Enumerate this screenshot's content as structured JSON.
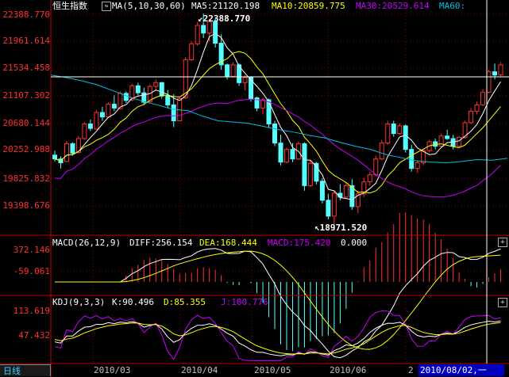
{
  "main_header": {
    "title": "恒生指数",
    "ma_label": "MA(5,10,30,60)",
    "ma5": "MA5:21120.198",
    "ma10": "MA10:20859.775",
    "ma30": "MA30:20529.614",
    "ma60": "MA60:"
  },
  "main_axis": {
    "labels": [
      "22388.770",
      "21961.614",
      "21534.458",
      "21107.302",
      "20680.144",
      "20252.988",
      "19825.832",
      "19398.676"
    ]
  },
  "annotations": {
    "high": "22388.770",
    "low": "18971.520"
  },
  "macd_header": {
    "label": "MACD(26,12,9)",
    "diff": "DIFF:256.154",
    "dea": "DEA:168.444",
    "macd": "MACD:175.420",
    "zero": "0.000"
  },
  "macd_axis": {
    "labels": [
      "372.146",
      "-59.061"
    ]
  },
  "kdj_header": {
    "label": "KDJ(9,3,3)",
    "k": "K:90.496",
    "d": "D:85.355",
    "j": "J:100.776"
  },
  "kdj_axis": {
    "labels": [
      "113.619",
      "47.432"
    ]
  },
  "bottom_bar": {
    "tab": "日线",
    "months": [
      "2010/03",
      "2010/04",
      "2010/05",
      "2010/06",
      "2"
    ],
    "current_date": "2010/08/02,一"
  },
  "panel_buttons": {
    "macd": "+",
    "kdj": "+"
  },
  "colors": {
    "rise": "#ff3232",
    "fall": "#54ffff",
    "ma5": "#ffffff",
    "ma10": "#ffff00",
    "ma30": "#c800ff",
    "ma60": "#00c0e0",
    "grid": "#800000"
  },
  "chart_data": {
    "type": "candlestick",
    "title": "恒生指数",
    "ylim": [
      18900,
      22450
    ],
    "high_mark": 22388.77,
    "low_mark": 18971.52,
    "ma_last": {
      "ma5": 21120.198,
      "ma10": 20859.775,
      "ma30": 20529.614
    },
    "ma60_start": 21420,
    "ma60_points": [
      21420,
      21380,
      21330,
      21270,
      21180,
      21090,
      21010,
      20950,
      20880,
      20860,
      20770,
      20700,
      20680,
      20660,
      20610,
      20560,
      20520,
      20470,
      20430,
      20360,
      20300,
      20250,
      20170,
      20120,
      20070,
      20050,
      20040,
      20060,
      20090,
      20080,
      20110
    ],
    "candles": [
      [
        20160,
        20230,
        20060,
        20100
      ],
      [
        20100,
        20140,
        19950,
        20040
      ],
      [
        20060,
        20380,
        20050,
        20340
      ],
      [
        20340,
        20360,
        20150,
        20190
      ],
      [
        20200,
        20460,
        20180,
        20420
      ],
      [
        20420,
        20680,
        20400,
        20650
      ],
      [
        20650,
        20720,
        20540,
        20580
      ],
      [
        20570,
        20870,
        20560,
        20830
      ],
      [
        20830,
        20920,
        20700,
        20760
      ],
      [
        20760,
        20990,
        20740,
        20960
      ],
      [
        20960,
        21100,
        20850,
        20900
      ],
      [
        20890,
        21160,
        20880,
        21130
      ],
      [
        21130,
        21160,
        20980,
        21020
      ],
      [
        21030,
        21280,
        21010,
        21250
      ],
      [
        21250,
        21300,
        21100,
        21140
      ],
      [
        21140,
        21220,
        20950,
        20990
      ],
      [
        21000,
        21270,
        20980,
        21240
      ],
      [
        21240,
        21350,
        21180,
        21300
      ],
      [
        21300,
        21310,
        21050,
        21090
      ],
      [
        21090,
        21180,
        20900,
        20950
      ],
      [
        20950,
        21120,
        20600,
        20700
      ],
      [
        20700,
        21080,
        20690,
        21050
      ],
      [
        21060,
        21700,
        21040,
        21660
      ],
      [
        21660,
        21950,
        21640,
        21910
      ],
      [
        21910,
        22250,
        21880,
        22200
      ],
      [
        22200,
        22389,
        22000,
        22080
      ],
      [
        22080,
        22300,
        21950,
        22260
      ],
      [
        22260,
        22310,
        21850,
        21920
      ],
      [
        21920,
        22060,
        21500,
        21580
      ],
      [
        21580,
        21600,
        21350,
        21400
      ],
      [
        21400,
        21620,
        21380,
        21580
      ],
      [
        21580,
        21600,
        21250,
        21300
      ],
      [
        21300,
        21420,
        21180,
        21380
      ],
      [
        21380,
        21400,
        21000,
        21050
      ],
      [
        21060,
        21080,
        20850,
        20900
      ],
      [
        20900,
        21060,
        20800,
        21030
      ],
      [
        21030,
        21050,
        20600,
        20650
      ],
      [
        20650,
        20700,
        20300,
        20350
      ],
      [
        20350,
        20480,
        20000,
        20050
      ],
      [
        20050,
        20280,
        20030,
        20250
      ],
      [
        20250,
        20350,
        20050,
        20100
      ],
      [
        20100,
        20380,
        20080,
        20340
      ],
      [
        20340,
        20360,
        19600,
        19680
      ],
      [
        19680,
        20080,
        19660,
        20030
      ],
      [
        20030,
        20050,
        19700,
        19750
      ],
      [
        19750,
        19800,
        19400,
        19450
      ],
      [
        19450,
        19550,
        19150,
        19200
      ],
      [
        19200,
        19600,
        18972,
        19560
      ],
      [
        19560,
        19700,
        19450,
        19500
      ],
      [
        19500,
        19720,
        19480,
        19680
      ],
      [
        19680,
        19780,
        19300,
        19350
      ],
      [
        19350,
        19600,
        19250,
        19550
      ],
      [
        19550,
        19800,
        19500,
        19740
      ],
      [
        19740,
        19900,
        19680,
        19850
      ],
      [
        19850,
        20150,
        19830,
        20100
      ],
      [
        20100,
        20400,
        20080,
        20350
      ],
      [
        20350,
        20700,
        20320,
        20650
      ],
      [
        20650,
        20700,
        20450,
        20500
      ],
      [
        20500,
        20660,
        20480,
        20620
      ],
      [
        20620,
        20640,
        20200,
        20250
      ],
      [
        20250,
        20320,
        19900,
        19950
      ],
      [
        19950,
        20080,
        19880,
        20040
      ],
      [
        20040,
        20260,
        20000,
        20230
      ],
      [
        20230,
        20400,
        20200,
        20370
      ],
      [
        20370,
        20420,
        20250,
        20300
      ],
      [
        20300,
        20500,
        20280,
        20460
      ],
      [
        20460,
        20560,
        20400,
        20420
      ],
      [
        20420,
        20480,
        20250,
        20300
      ],
      [
        20300,
        20460,
        20280,
        20440
      ],
      [
        20440,
        20700,
        20420,
        20670
      ],
      [
        20670,
        20900,
        20650,
        20850
      ],
      [
        20850,
        21000,
        20800,
        20950
      ],
      [
        20950,
        21200,
        20930,
        21150
      ],
      [
        21150,
        21500,
        21130,
        21470
      ],
      [
        21470,
        21600,
        21350,
        21420
      ],
      [
        21420,
        21620,
        21400,
        21580
      ]
    ],
    "macd_ylim": [
      -150,
      420
    ],
    "kdj_ylim": [
      -10,
      130
    ]
  }
}
